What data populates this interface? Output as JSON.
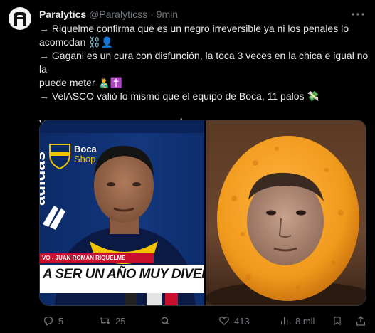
{
  "author": {
    "name": "Paralytics",
    "handle": "@Paralyticss",
    "dot": "·",
    "time": "9min"
  },
  "body": {
    "line1": "→ Riquelme confirma que es un negro irreversible ya ni los penales lo",
    "line2": "acomodan ⛓️👤",
    "line3": "→ Gagani es un cura con disfunción, la toca 3 veces en la chica e igual no la",
    "line4": "puede meter 👨‍🍼✝️",
    "line5": "→ VelASCO valió lo mismo que el equipo de Boca, 11 palos 💸",
    "line6": "Va a ser un año muy divertido ✍🏻"
  },
  "media": {
    "left_logo_line1": "Boca",
    "left_logo_line2": "Shop",
    "left_brand": "adidas",
    "left_caption_top": "VO - JUAN ROMÁN RIQUELME",
    "left_caption": "A SER UN AÑO MUY DIVERTIDO\""
  },
  "actions": {
    "replies": "5",
    "reposts": "25",
    "likes": "413",
    "views": "8 mil"
  },
  "colors": {
    "background": "#000000",
    "text": "#e7e9ea",
    "muted": "#71767b",
    "border": "#2f3336"
  }
}
